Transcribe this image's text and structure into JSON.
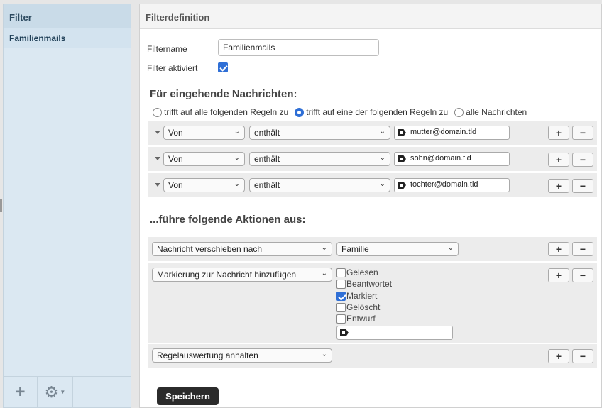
{
  "sidebar": {
    "title": "Filter",
    "items": [
      {
        "label": "Familienmails"
      }
    ],
    "footer": {
      "add_icon": "plus-icon",
      "settings_icon": "gear-icon"
    }
  },
  "main": {
    "title": "Filterdefinition",
    "filtername_label": "Filtername",
    "filtername_value": "Familienmails",
    "enabled_label": "Filter aktiviert",
    "enabled": true,
    "incoming_title": "Für eingehende Nachrichten:",
    "match_options": [
      {
        "label": "trifft auf alle folgenden Regeln zu",
        "selected": false
      },
      {
        "label": "trifft auf eine der folgenden Regeln zu",
        "selected": true
      },
      {
        "label": "alle Nachrichten",
        "selected": false
      }
    ],
    "rules": [
      {
        "field": "Von",
        "operator": "enthält",
        "value": "mutter@domain.tld"
      },
      {
        "field": "Von",
        "operator": "enthält",
        "value": "sohn@domain.tld"
      },
      {
        "field": "Von",
        "operator": "enthält",
        "value": "tochter@domain.tld"
      }
    ],
    "actions_title": "...führe folgende Aktionen aus:",
    "actions": [
      {
        "action": "Nachricht verschieben nach",
        "target": "Familie"
      },
      {
        "action": "Markierung zur Nachricht hinzufügen"
      },
      {
        "action": "Regelauswertung anhalten"
      }
    ],
    "flags": [
      {
        "label": "Gelesen",
        "checked": false
      },
      {
        "label": "Beantwortet",
        "checked": false
      },
      {
        "label": "Markiert",
        "checked": true
      },
      {
        "label": "Gelöscht",
        "checked": false
      },
      {
        "label": "Entwurf",
        "checked": false
      }
    ],
    "plus_label": "+",
    "minus_label": "−",
    "save_label": "Speichern"
  }
}
